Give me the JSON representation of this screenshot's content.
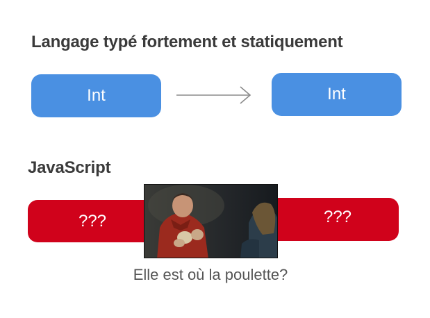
{
  "sections": {
    "static": {
      "title": "Langage typé fortement et statiquement",
      "left_box": "Int",
      "right_box": "Int",
      "arrow_icon": "right-arrow-icon"
    },
    "javascript": {
      "title": "JavaScript",
      "left_box": "???",
      "right_box": "???",
      "image_icon": "meme-image",
      "caption": "Elle est où la poulette?"
    }
  },
  "colors": {
    "heading": "#3a3a3a",
    "blue_box": "#4a90e2",
    "red_box": "#d0021b",
    "arrow": "#8a8a8a",
    "caption": "#555555"
  }
}
